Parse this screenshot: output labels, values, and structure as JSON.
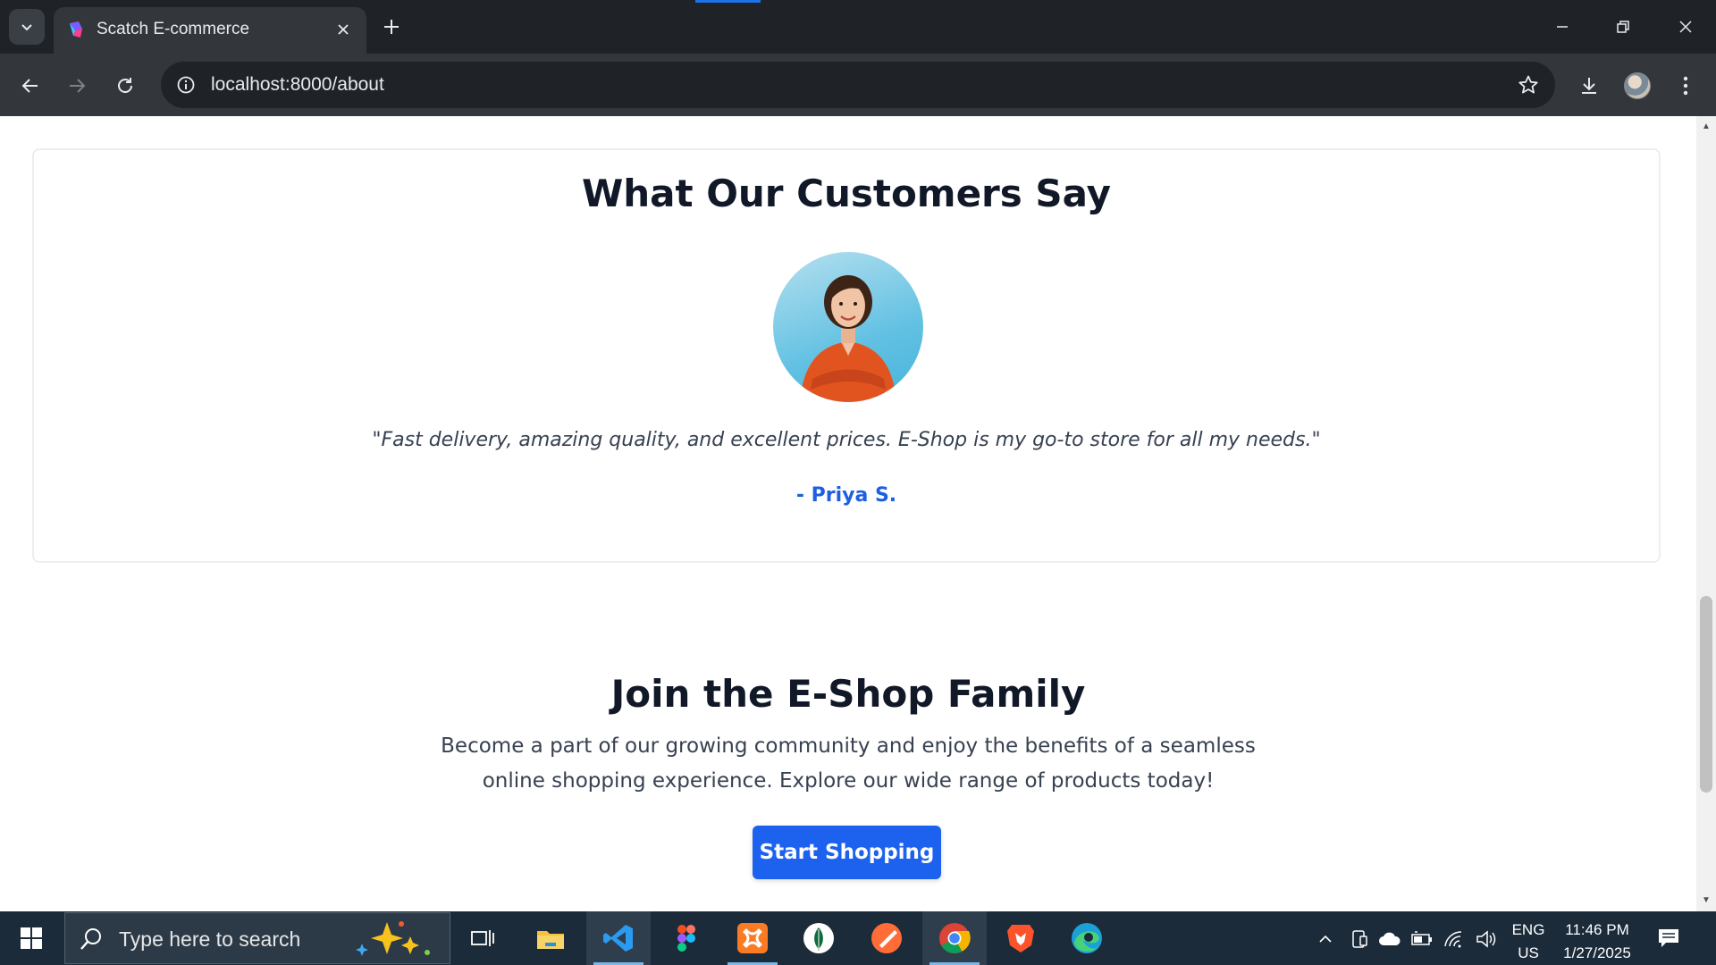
{
  "browser": {
    "tab_title": "Scatch E-commerce",
    "url": "localhost:8000/about"
  },
  "page": {
    "testimonials": {
      "title": "What Our Customers Say",
      "quote": "\"Fast delivery, amazing quality, and excellent prices. E-Shop is my go-to store for all my needs.\"",
      "author": "- Priya S."
    },
    "join": {
      "title": "Join the E-Shop Family",
      "text": "Become a part of our growing community and enjoy the benefits of a seamless online shopping experience. Explore our wide range of products today!",
      "cta_label": "Start Shopping"
    }
  },
  "taskbar": {
    "search_placeholder": "Type here to search",
    "apps": [
      "task-view",
      "file-explorer",
      "vs-code",
      "figma",
      "xampp",
      "mongodb-compass",
      "postman",
      "chrome",
      "brave",
      "edge"
    ],
    "language": {
      "line1": "ENG",
      "line2": "US"
    },
    "clock": {
      "time": "11:46 PM",
      "date": "1/27/2025"
    }
  },
  "colors": {
    "accent_blue": "#1d62ef",
    "author_blue": "#1d5fe0",
    "chrome_dark": "#1f2327",
    "taskbar": "#1c2b3a"
  }
}
